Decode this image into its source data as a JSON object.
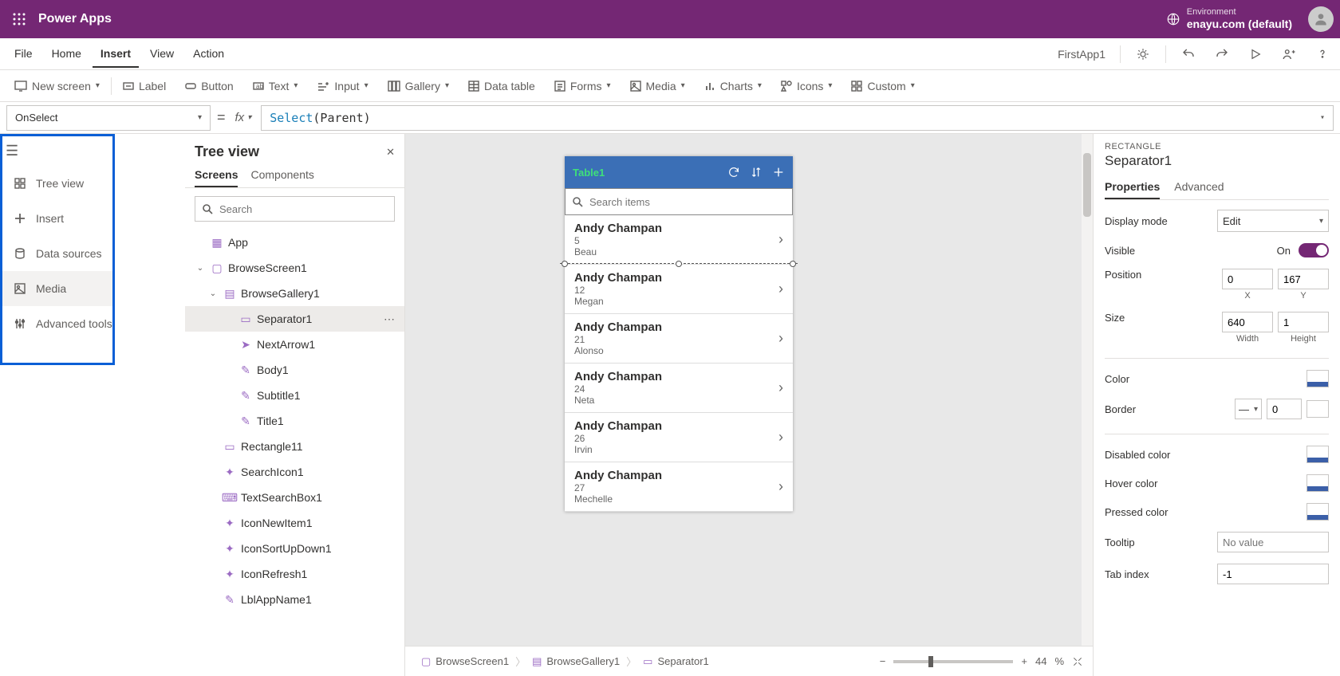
{
  "header": {
    "app_title": "Power Apps",
    "env_label": "Environment",
    "env_name": "enayu.com (default)"
  },
  "menubar": {
    "items": [
      "File",
      "Home",
      "Insert",
      "View",
      "Action"
    ],
    "active": "Insert",
    "app_name": "FirstApp1"
  },
  "ribbon": {
    "new_screen": "New screen",
    "label": "Label",
    "button": "Button",
    "text": "Text",
    "input": "Input",
    "gallery": "Gallery",
    "data_table": "Data table",
    "forms": "Forms",
    "media": "Media",
    "charts": "Charts",
    "icons": "Icons",
    "custom": "Custom"
  },
  "formula": {
    "property": "OnSelect",
    "fn": "Select",
    "arg": "(Parent)"
  },
  "left_rail": {
    "items": [
      {
        "icon": "tree",
        "label": "Tree view"
      },
      {
        "icon": "plus",
        "label": "Insert"
      },
      {
        "icon": "data",
        "label": "Data sources"
      },
      {
        "icon": "media",
        "label": "Media"
      },
      {
        "icon": "tools",
        "label": "Advanced tools"
      }
    ]
  },
  "tree": {
    "title": "Tree view",
    "tabs": [
      "Screens",
      "Components"
    ],
    "active_tab": "Screens",
    "search_placeholder": "Search",
    "items": [
      {
        "level": 0,
        "icon": "app",
        "label": "App"
      },
      {
        "level": 0,
        "icon": "screen",
        "label": "BrowseScreen1",
        "expanded": true
      },
      {
        "level": 1,
        "icon": "gallery",
        "label": "BrowseGallery1",
        "expanded": true
      },
      {
        "level": 2,
        "icon": "sep",
        "label": "Separator1",
        "selected": true
      },
      {
        "level": 2,
        "icon": "arrow",
        "label": "NextArrow1"
      },
      {
        "level": 2,
        "icon": "text",
        "label": "Body1"
      },
      {
        "level": 2,
        "icon": "text",
        "label": "Subtitle1"
      },
      {
        "level": 2,
        "icon": "text",
        "label": "Title1"
      },
      {
        "level": 1,
        "icon": "rect",
        "label": "Rectangle11"
      },
      {
        "level": 1,
        "icon": "icon",
        "label": "SearchIcon1"
      },
      {
        "level": 1,
        "icon": "input",
        "label": "TextSearchBox1"
      },
      {
        "level": 1,
        "icon": "icon",
        "label": "IconNewItem1"
      },
      {
        "level": 1,
        "icon": "icon",
        "label": "IconSortUpDown1"
      },
      {
        "level": 1,
        "icon": "icon",
        "label": "IconRefresh1"
      },
      {
        "level": 1,
        "icon": "text",
        "label": "LblAppName1"
      }
    ]
  },
  "canvas": {
    "title": "Table1",
    "search_placeholder": "Search items",
    "rows": [
      {
        "title": "Andy Champan",
        "sub1": "5",
        "sub2": "Beau",
        "selected": true
      },
      {
        "title": "Andy Champan",
        "sub1": "12",
        "sub2": "Megan"
      },
      {
        "title": "Andy Champan",
        "sub1": "21",
        "sub2": "Alonso"
      },
      {
        "title": "Andy Champan",
        "sub1": "24",
        "sub2": "Neta"
      },
      {
        "title": "Andy Champan",
        "sub1": "26",
        "sub2": "Irvin"
      },
      {
        "title": "Andy Champan",
        "sub1": "27",
        "sub2": "Mechelle"
      }
    ]
  },
  "props": {
    "type": "RECTANGLE",
    "name": "Separator1",
    "tabs": [
      "Properties",
      "Advanced"
    ],
    "active_tab": "Properties",
    "display_mode_label": "Display mode",
    "display_mode": "Edit",
    "visible_label": "Visible",
    "visible_text": "On",
    "position_label": "Position",
    "pos_x": "0",
    "pos_y": "167",
    "x_label": "X",
    "y_label": "Y",
    "size_label": "Size",
    "size_w": "640",
    "size_h": "1",
    "w_label": "Width",
    "h_label": "Height",
    "color_label": "Color",
    "border_label": "Border",
    "border_val": "0",
    "border_color": "#0a1e6e",
    "disabled_label": "Disabled color",
    "hover_label": "Hover color",
    "pressed_label": "Pressed color",
    "tooltip_label": "Tooltip",
    "tooltip_placeholder": "No value",
    "tabindex_label": "Tab index",
    "tabindex": "-1",
    "swatch_bar_color": "#3b5fa8"
  },
  "breadcrumb": {
    "items": [
      "BrowseScreen1",
      "BrowseGallery1",
      "Separator1"
    ],
    "zoom": "44",
    "zoom_unit": "%"
  }
}
